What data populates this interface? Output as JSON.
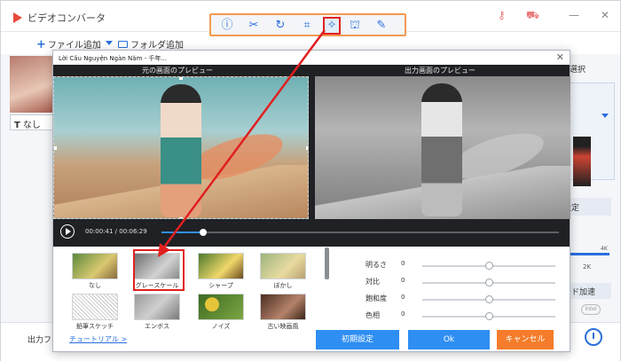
{
  "app": {
    "title": "ビデオコンバータ",
    "add_file": "ファイル追加",
    "add_folder": "フォルダ追加",
    "output_label": "出力フォ"
  },
  "right_pane": {
    "select_label": "定選択",
    "settings_label": "設定",
    "fix_label": "定",
    "scale_4k": "4K",
    "scale_2k": "2K",
    "accel_label": "ード加速",
    "intel_label": "Intel"
  },
  "subtitle_box": {
    "label": "なし"
  },
  "edit_toolbar": {
    "icons": [
      "info-icon",
      "cut-icon",
      "rotate-icon",
      "crop-icon",
      "effect-icon",
      "watermark-icon",
      "subtitle-icon"
    ],
    "active": "effect-icon"
  },
  "dialog": {
    "title": "Lời Câu Nguyện Ngàn Năm - 千年...",
    "original_preview_label": "元の画面のプレビュー",
    "output_preview_label": "出力画面のプレビュー",
    "time_current": "00:00:41",
    "time_total": "00:06:29",
    "progress": 0.105,
    "filters": [
      {
        "label": "なし",
        "thumb": "none"
      },
      {
        "label": "グレースケール",
        "thumb": "gray"
      },
      {
        "label": "シャープ",
        "thumb": "sharp"
      },
      {
        "label": "ぼかし",
        "thumb": "blur"
      },
      {
        "label": "鉛筆スケッチ",
        "thumb": "sketch"
      },
      {
        "label": "エンボス",
        "thumb": "emboss"
      },
      {
        "label": "ノイズ",
        "thumb": "noise"
      },
      {
        "label": "古い映画風",
        "thumb": "old"
      }
    ],
    "selected_filter": 1,
    "sliders": [
      {
        "label": "明るさ",
        "value": "0",
        "position": 0.5
      },
      {
        "label": "対比",
        "value": "0",
        "position": 0.5
      },
      {
        "label": "飽和度",
        "value": "0",
        "position": 0.5
      },
      {
        "label": "色相",
        "value": "0",
        "position": 0.5
      }
    ],
    "tutorial_link": "チュートリアル >",
    "reset_button": "初期設定",
    "ok_button": "Ok",
    "cancel_button": "キャンセル"
  },
  "colors": {
    "accent_blue": "#2f8ef2",
    "cancel_orange": "#f47c2a",
    "highlight_red": "#e02020",
    "toolbar_border_orange": "#f39a51"
  }
}
